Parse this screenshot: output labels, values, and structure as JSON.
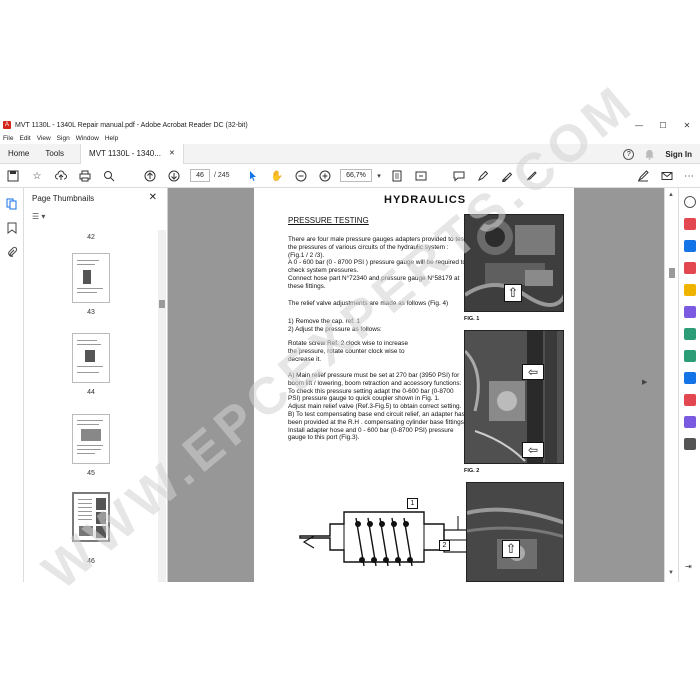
{
  "window": {
    "title": "MVT 1130L - 1340L Repair manual.pdf - Adobe Acrobat Reader DC (32-bit)",
    "minimize": "—",
    "maximize": "☐",
    "close": "✕"
  },
  "menu": [
    "File",
    "Edit",
    "View",
    "Sign",
    "Window",
    "Help"
  ],
  "tabs": {
    "home": "Home",
    "tools": "Tools",
    "document": "MVT 1130L - 1340...",
    "document_close": "✕",
    "sign_in": "Sign In",
    "help_icon": "?",
    "bell_icon": "bell-icon"
  },
  "toolbar": {
    "current_page": "46",
    "total_pages": "/ 245",
    "zoom": "66,7%",
    "icons": [
      "save-icon",
      "bookmark-star-icon",
      "upload-icon",
      "print-icon",
      "search-zoom-icon",
      "page-up-icon",
      "page-down-icon",
      "select-cursor-icon",
      "hand-icon",
      "zoom-out-icon",
      "zoom-in-icon",
      "zoom-dropdown-icon",
      "fit-page-icon",
      "scroll-mode-icon",
      "comment-icon",
      "highlight-pen-icon",
      "draw-icon",
      "sign-icon",
      "fill-sign-icon",
      "email-icon",
      "more-icon"
    ]
  },
  "thumbnails": {
    "header": "Page Thumbnails",
    "close": "✕",
    "options": "☰ ▾",
    "pages": [
      "42",
      "43",
      "44",
      "45",
      "46"
    ],
    "selected": "46"
  },
  "document_page": {
    "section_title": "HYDRAULICS",
    "heading": "PRESSURE TESTING",
    "para1": "There are four male pressure gauges adapters provided to test the pressures of various circuits of the hydraulic system : (Fig.1 / 2 /3).\nA 0 - 600 bar (0 - 8700  PSI ) pressure gauge will be required to check system pressures.\nConnect hose part N°72340 and pressure gauge N°58179 at these fittings.",
    "para2": "The relief valve adjustments are made as follows (Fig. 4)",
    "para3": "1) Remove the cap. ref. 1\n2) Adjust the pressure as follows:",
    "para4": "Rotate screw Ref. 2 clock wise to increase the pressure, rotate counter clock wise to decrease it.",
    "para5": "A) Main relief pressure must be set at 270 bar (3950 PSI) for boom lift / lowering, boom retraction and accessory functions:\nTo check this pressure setting adapt the 0-600 bar (0-8700 PSI) pressure gauge to quick coupler shown in Fig. 1.\nAdjust main relief valve (Ref.3-Fig.5) to obtain correct setting.\nB) To test compensating base end circuit relief, an adapter has been provided at the R.H . compensating cylinder base fittings.\nInstall adapter hose and 0 - 600 bar (0-8700 PSI) pressure gauge to this port (Fig.3).",
    "fig1_label": "FIG. 1",
    "fig2_label": "FIG. 2",
    "callout1": "1",
    "callout2": "2"
  },
  "watermark_text": "WWW.EPCEXPERTS.COM"
}
